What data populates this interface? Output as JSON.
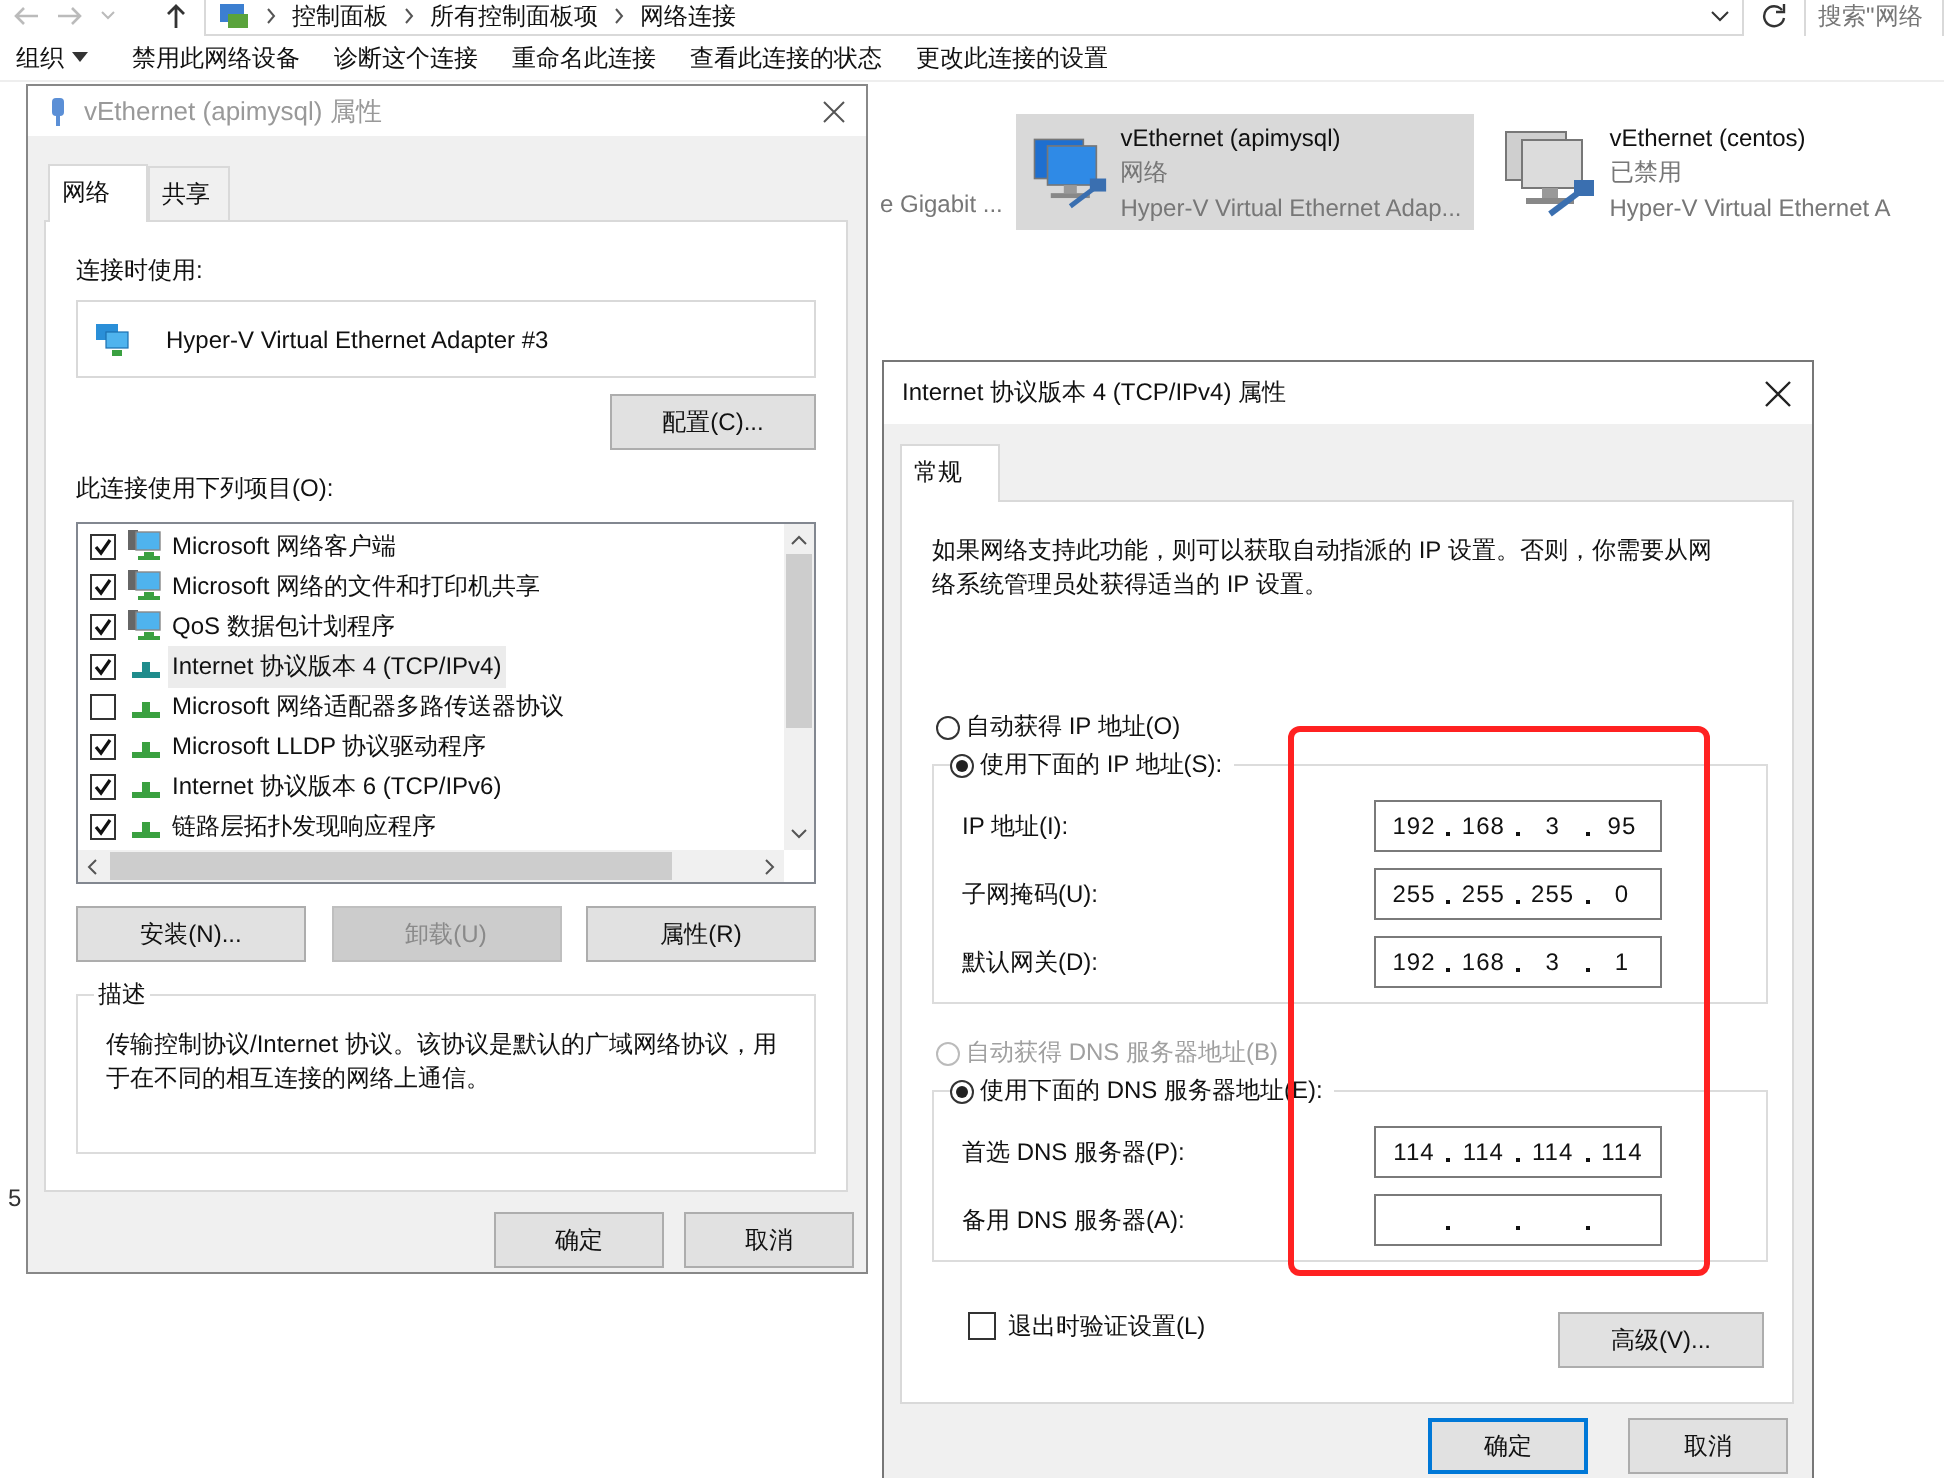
{
  "explorer": {
    "breadcrumbs": [
      "控制面板",
      "所有控制面板项",
      "网络连接"
    ],
    "search": {
      "placeholder": "搜索\"网络"
    },
    "organize_menu": "组织",
    "commands": [
      "禁用此网络设备",
      "诊断这个连接",
      "重命名此连接",
      "查看此连接的状态",
      "更改此连接的设置"
    ],
    "adapters": [
      {
        "device": "e Gigabit ...",
        "selected": false,
        "kind": "partial"
      },
      {
        "name": "vEthernet (apimysql)",
        "status": "网络",
        "device": "Hyper-V Virtual Ethernet Adap...",
        "selected": true,
        "kind": "full"
      },
      {
        "name": "vEthernet (centos)",
        "status": "已禁用",
        "device": "Hyper-V Virtual Ethernet A",
        "selected": false,
        "kind": "full"
      }
    ],
    "status_fragment": "5"
  },
  "properties_dialog": {
    "title": "vEthernet (apimysql) 属性",
    "tabs": [
      {
        "label": "网络",
        "selected": true
      },
      {
        "label": "共享",
        "selected": false
      }
    ],
    "connect_using_label": "连接时使用:",
    "adapter": "Hyper-V Virtual Ethernet Adapter #3",
    "configure_button": "配置(C)...",
    "items_label": "此连接使用下列项目(O):",
    "items": [
      {
        "label": "Microsoft 网络客户端",
        "checked": true,
        "selected": false,
        "kind": "client"
      },
      {
        "label": "Microsoft 网络的文件和打印机共享",
        "checked": true,
        "selected": false,
        "kind": "client"
      },
      {
        "label": "QoS 数据包计划程序",
        "checked": true,
        "selected": false,
        "kind": "client"
      },
      {
        "label": "Internet 协议版本 4 (TCP/IPv4)",
        "checked": true,
        "selected": true,
        "kind": "protocol"
      },
      {
        "label": "Microsoft 网络适配器多路传送器协议",
        "checked": false,
        "selected": false,
        "kind": "protocol"
      },
      {
        "label": "Microsoft LLDP 协议驱动程序",
        "checked": true,
        "selected": false,
        "kind": "protocol"
      },
      {
        "label": "Internet 协议版本 6 (TCP/IPv6)",
        "checked": true,
        "selected": false,
        "kind": "protocol"
      },
      {
        "label": "链路层拓扑发现响应程序",
        "checked": true,
        "selected": false,
        "kind": "protocol"
      }
    ],
    "buttons": [
      {
        "label": "安装(N)...",
        "disabled": false
      },
      {
        "label": "卸载(U)",
        "disabled": true
      },
      {
        "label": "属性(R)",
        "disabled": false
      }
    ],
    "description_title": "描述",
    "description": "传输控制协议/Internet 协议。该协议是默认的广域网络协议，用于在不同的相互连接的网络上通信。",
    "footer_buttons": [
      {
        "label": "确定",
        "default": false
      },
      {
        "label": "取消",
        "default": false
      }
    ]
  },
  "ipv4_dialog": {
    "title": "Internet 协议版本 4 (TCP/IPv4) 属性",
    "tabs": [
      {
        "label": "常规",
        "selected": true
      }
    ],
    "intro": "如果网络支持此功能，则可以获取自动指派的 IP 设置。否则，你需要从网络系统管理员处获得适当的 IP 设置。",
    "ip_mode": [
      {
        "label": "自动获得 IP 地址(O)",
        "selected": false,
        "disabled": false
      },
      {
        "label": "使用下面的 IP 地址(S):",
        "selected": true,
        "disabled": false
      }
    ],
    "ip_fields": [
      {
        "label": "IP 地址(I):",
        "octets": [
          "192",
          "168",
          "3",
          "95"
        ]
      },
      {
        "label": "子网掩码(U):",
        "octets": [
          "255",
          "255",
          "255",
          "0"
        ]
      },
      {
        "label": "默认网关(D):",
        "octets": [
          "192",
          "168",
          "3",
          "1"
        ]
      }
    ],
    "dns_mode": [
      {
        "label": "自动获得 DNS 服务器地址(B)",
        "selected": false,
        "disabled": true
      },
      {
        "label": "使用下面的 DNS 服务器地址(E):",
        "selected": true,
        "disabled": false
      }
    ],
    "dns_fields": [
      {
        "label": "首选 DNS 服务器(P):",
        "octets": [
          "114",
          "114",
          "114",
          "114"
        ]
      },
      {
        "label": "备用 DNS 服务器(A):"
      }
    ],
    "validate": {
      "label": "退出时验证设置(L)",
      "checked": false
    },
    "advanced_button": "高级(V)...",
    "footer_buttons": [
      {
        "label": "确定",
        "default": true
      },
      {
        "label": "取消",
        "default": false
      }
    ]
  }
}
